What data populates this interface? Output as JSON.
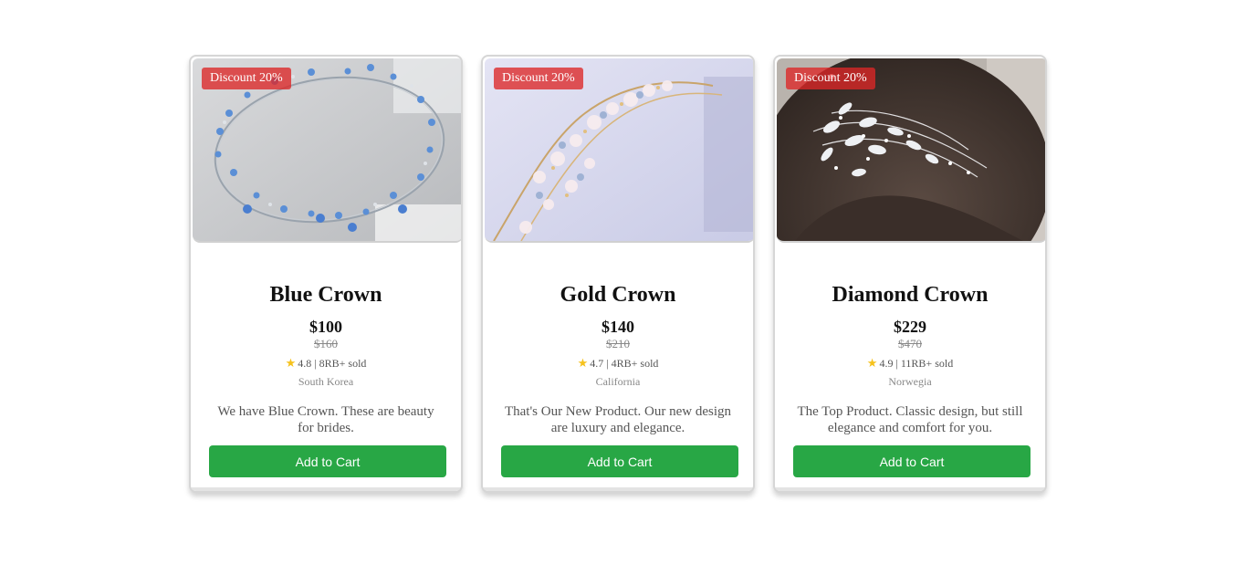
{
  "products": [
    {
      "badge": "Discount 20%",
      "name": "Blue Crown",
      "price": "$100",
      "old_price": "$160",
      "rating": "4.8",
      "sold": "8RB+ sold",
      "origin": "South Korea",
      "description": "We have Blue Crown. These are beauty for brides.",
      "button": "Add to Cart",
      "image": "blue-crystal-crown-photo"
    },
    {
      "badge": "Discount 20%",
      "name": "Gold Crown",
      "price": "$140",
      "old_price": "$210",
      "rating": "4.7",
      "sold": "4RB+ sold",
      "origin": "California",
      "description": "That's Our New Product. Our new design are luxury and elegance.",
      "button": "Add to Cart",
      "image": "gold-flower-crown-photo"
    },
    {
      "badge": "Discount 20%",
      "name": "Diamond Crown",
      "price": "$229",
      "old_price": "$470",
      "rating": "4.9",
      "sold": "11RB+ sold",
      "origin": "Norwegia",
      "description": "The Top Product. Classic design, but still elegance and comfort for you.",
      "button": "Add to Cart",
      "image": "diamond-hair-comb-photo"
    }
  ],
  "colors": {
    "accent": "#28a745",
    "badge": "#dc2626",
    "star": "#f6c21c"
  },
  "icons": {
    "rating": "star-icon"
  }
}
